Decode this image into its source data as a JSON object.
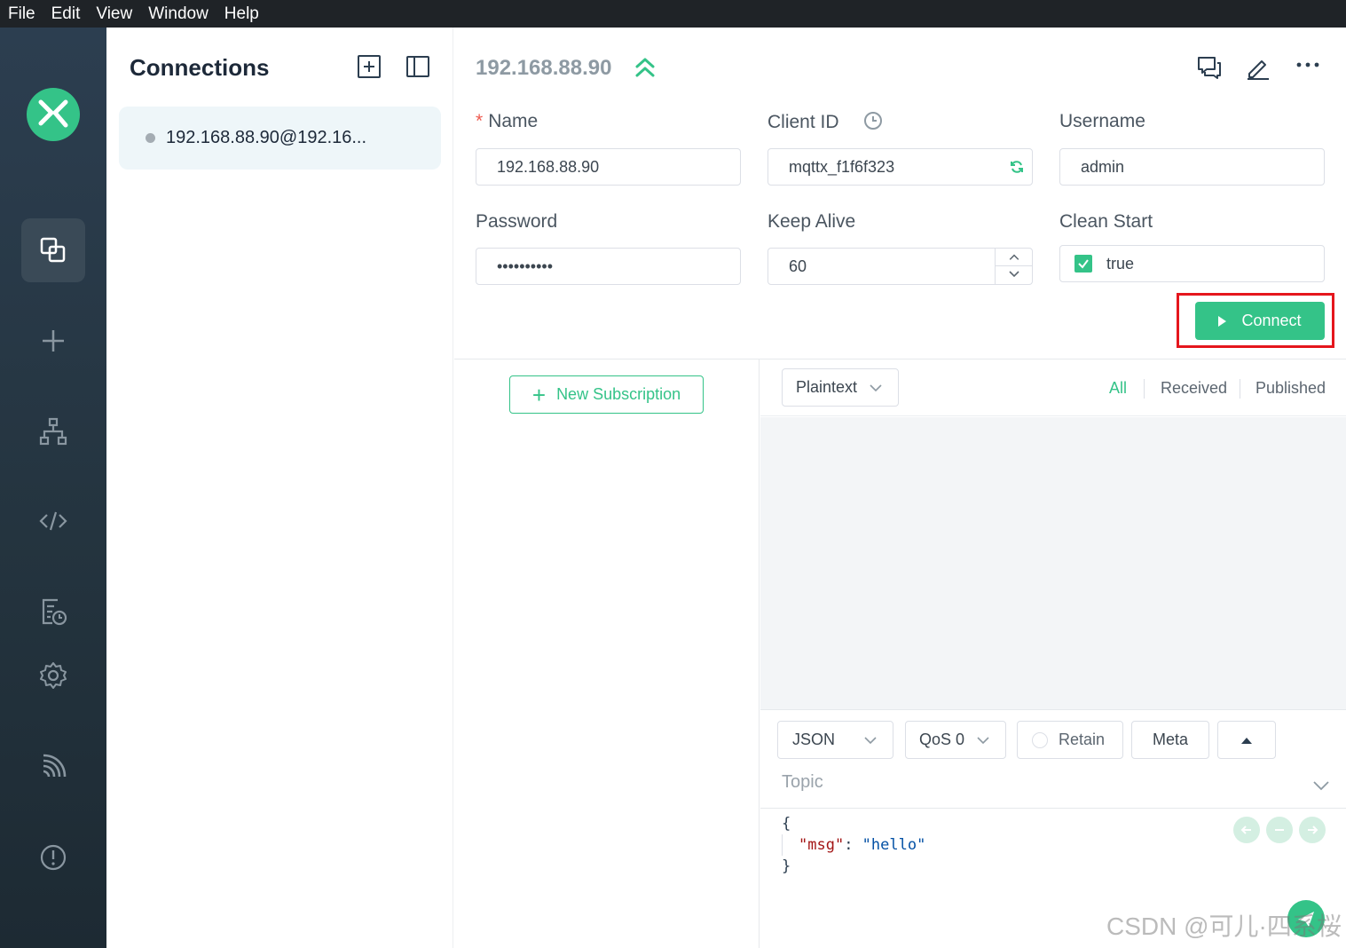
{
  "menubar": {
    "items": [
      "File",
      "Edit",
      "View",
      "Window",
      "Help"
    ]
  },
  "sidebar": {
    "icons": [
      "connections-icon",
      "plus-icon",
      "topology-icon",
      "script-icon",
      "log-icon",
      "settings-icon",
      "feed-icon",
      "about-icon"
    ],
    "active": "connections-icon"
  },
  "connections": {
    "title": "Connections",
    "items": [
      {
        "label": "192.168.88.90@192.16...",
        "status": "disconnected"
      }
    ]
  },
  "header": {
    "name": "192.168.88.90"
  },
  "form": {
    "name_label": "Name",
    "name_value": "192.168.88.90",
    "client_id_label": "Client ID",
    "client_id_value": "mqttx_f1f6f323",
    "username_label": "Username",
    "username_value": "admin",
    "password_label": "Password",
    "password_value": "••••••••••",
    "keep_alive_label": "Keep Alive",
    "keep_alive_value": "60",
    "clean_start_label": "Clean Start",
    "clean_start_value": "true",
    "connect_label": "Connect"
  },
  "subscriptions": {
    "new_label": "New Subscription"
  },
  "messages": {
    "format": "Plaintext",
    "filters": [
      "All",
      "Received",
      "Published"
    ],
    "active_filter": "All"
  },
  "publish": {
    "payload_format": "JSON",
    "qos": "QoS 0",
    "retain_label": "Retain",
    "meta_label": "Meta",
    "topic_placeholder": "Topic",
    "payload_lines": [
      "{",
      "\"msg\"",
      "\"hello\"",
      "}"
    ]
  },
  "watermark": "CSDN @可儿·四系桜",
  "colors": {
    "accent": "#34c388",
    "sidebar": "#2c3e50",
    "highlight": "#e5161d"
  }
}
